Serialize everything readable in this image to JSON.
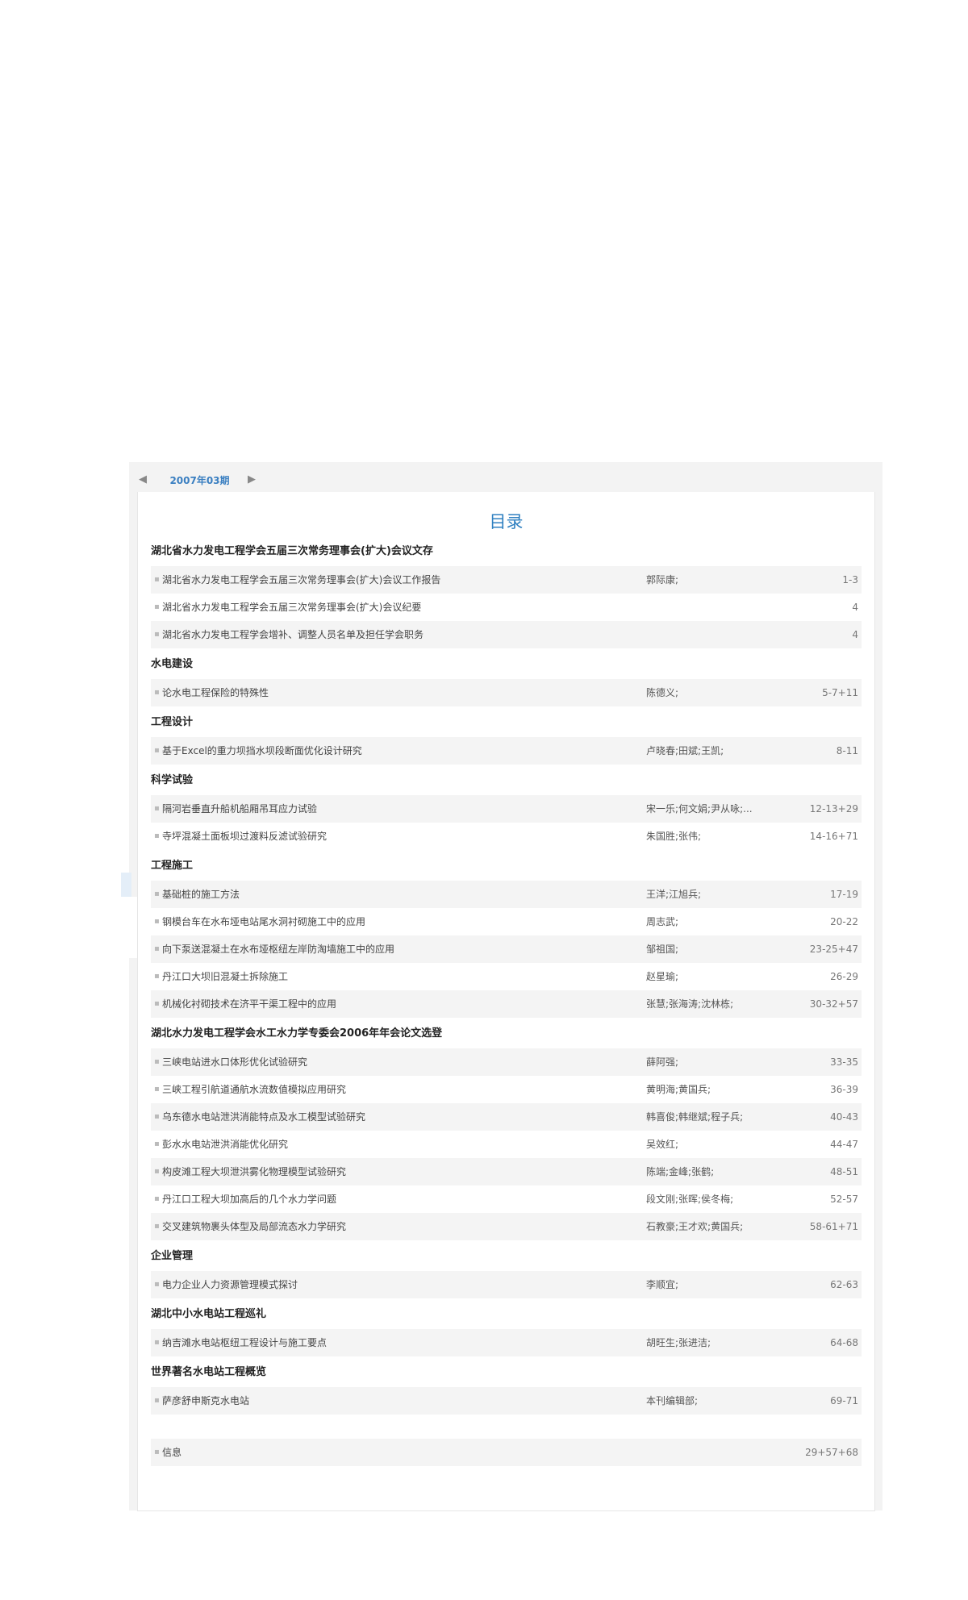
{
  "issue_nav": {
    "prev": "◀",
    "next": "▶",
    "label": "2007年03期"
  },
  "toc_title": "目录",
  "sections": [
    {
      "name": "湖北省水力发电工程学会五届三次常务理事会(扩大)会议文存",
      "items": [
        {
          "title": "湖北省水力发电工程学会五届三次常务理事会(扩大)会议工作报告",
          "author": "郭际康;",
          "pages": "1-3"
        },
        {
          "title": "湖北省水力发电工程学会五届三次常务理事会(扩大)会议纪要",
          "author": "",
          "pages": "4"
        },
        {
          "title": "湖北省水力发电工程学会增补、调整人员名单及担任学会职务",
          "author": "",
          "pages": "4"
        }
      ]
    },
    {
      "name": "水电建设",
      "items": [
        {
          "title": "论水电工程保险的特殊性",
          "author": "陈德义;",
          "pages": "5-7+11"
        }
      ]
    },
    {
      "name": "工程设计",
      "items": [
        {
          "title": "基于Excel的重力坝挡水坝段断面优化设计研究",
          "author": "卢晓春;田斌;王凯;",
          "pages": "8-11"
        }
      ]
    },
    {
      "name": "科学试验",
      "items": [
        {
          "title": "隔河岩垂直升船机船厢吊耳应力试验",
          "author": "宋一乐;何文娟;尹从咏;...",
          "pages": "12-13+29"
        },
        {
          "title": "寺坪混凝土面板坝过渡料反滤试验研究",
          "author": "朱国胜;张伟;",
          "pages": "14-16+71"
        }
      ]
    },
    {
      "name": "工程施工",
      "items": [
        {
          "title": "基础桩的施工方法",
          "author": "王洋;江旭兵;",
          "pages": "17-19"
        },
        {
          "title": "钢模台车在水布垭电站尾水洞衬砌施工中的应用",
          "author": "周志武;",
          "pages": "20-22"
        },
        {
          "title": "向下泵送混凝土在水布垭枢纽左岸防淘墙施工中的应用",
          "author": "邹祖国;",
          "pages": "23-25+47"
        },
        {
          "title": "丹江口大坝旧混凝土拆除施工",
          "author": "赵星瑜;",
          "pages": "26-29"
        },
        {
          "title": "机械化衬砌技术在济平干渠工程中的应用",
          "author": "张慧;张海涛;沈林栋;",
          "pages": "30-32+57"
        }
      ]
    },
    {
      "name": "湖北水力发电工程学会水工水力学专委会2006年年会论文选登",
      "items": [
        {
          "title": "三峡电站进水口体形优化试验研究",
          "author": "薛阿强;",
          "pages": "33-35"
        },
        {
          "title": "三峡工程引航道通航水流数值模拟应用研究",
          "author": "黄明海;黄国兵;",
          "pages": "36-39"
        },
        {
          "title": "乌东德水电站泄洪消能特点及水工模型试验研究",
          "author": "韩喜俊;韩继斌;程子兵;",
          "pages": "40-43"
        },
        {
          "title": "彭水水电站泄洪消能优化研究",
          "author": "吴效红;",
          "pages": "44-47"
        },
        {
          "title": "构皮滩工程大坝泄洪雾化物理模型试验研究",
          "author": "陈端;金峰;张鹤;",
          "pages": "48-51"
        },
        {
          "title": "丹江口工程大坝加高后的几个水力学问题",
          "author": "段文刚;张晖;侯冬梅;",
          "pages": "52-57"
        },
        {
          "title": "交叉建筑物裹头体型及局部流态水力学研究",
          "author": "石教豪;王才欢;黄国兵;",
          "pages": "58-61+71"
        }
      ]
    },
    {
      "name": "企业管理",
      "items": [
        {
          "title": "电力企业人力资源管理模式探讨",
          "author": "李顺宜;",
          "pages": "62-63"
        }
      ]
    },
    {
      "name": "湖北中小水电站工程巡礼",
      "items": [
        {
          "title": "纳吉滩水电站枢纽工程设计与施工要点",
          "author": "胡旺生;张进洁;",
          "pages": "64-68"
        }
      ]
    },
    {
      "name": "世界著名水电站工程概览",
      "items": [
        {
          "title": "萨彦舒申斯克水电站",
          "author": "本刊编辑部;",
          "pages": "69-71"
        }
      ]
    },
    {
      "name": "",
      "items": [
        {
          "title": "信息",
          "author": "",
          "pages": "29+57+68"
        }
      ]
    }
  ]
}
